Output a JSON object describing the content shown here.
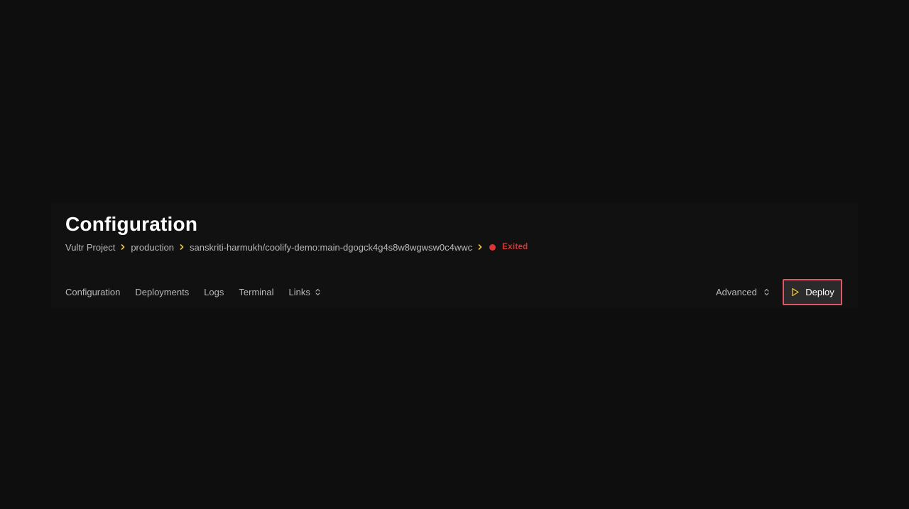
{
  "header": {
    "title": "Configuration"
  },
  "breadcrumb": {
    "project": "Vultr Project",
    "environment": "production",
    "resource": "sanskriti-harmukh/coolify-demo:main-dgogck4g4s8w8wgwsw0c4wwc",
    "status": "Exited"
  },
  "tabs": [
    {
      "label": "Configuration"
    },
    {
      "label": "Deployments"
    },
    {
      "label": "Logs"
    },
    {
      "label": "Terminal"
    },
    {
      "label": "Links"
    }
  ],
  "actions": {
    "advanced_label": "Advanced",
    "deploy_label": "Deploy"
  },
  "colors": {
    "background": "#0e0e0e",
    "panel": "#111111",
    "accent_yellow": "#f0c43c",
    "status_red": "#dc3535",
    "highlight_border": "#e2566a"
  },
  "icons": {
    "breadcrumb_separator": "chevron-right-icon",
    "status": "status-dot-icon",
    "links_toggle": "chevron-up-down-icon",
    "advanced_toggle": "chevron-up-down-icon",
    "deploy": "play-icon"
  }
}
